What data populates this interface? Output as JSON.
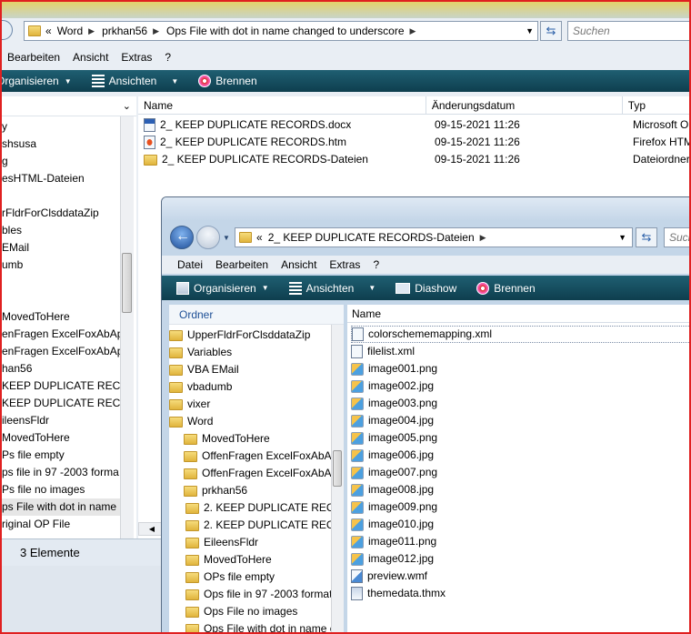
{
  "back_window": {
    "address": {
      "chevron": "«",
      "segments": [
        "Word",
        "prkhan56",
        "Ops File with dot in name changed to underscore"
      ]
    },
    "search_placeholder": "Suchen",
    "menu": [
      "Bearbeiten",
      "Ansicht",
      "Extras",
      "?"
    ],
    "commands": {
      "organize": "Organisieren",
      "views": "Ansichten",
      "burn": "Brennen"
    },
    "sidebar_items": [
      "y",
      "shsusa",
      "g",
      "esHTML-Dateien",
      "",
      "rFldrForClsddataZip",
      "bles",
      "EMail",
      "umb",
      "",
      "",
      "MovedToHere",
      "enFragen ExcelFoxAbAp",
      "enFragen ExcelFoxAbAp",
      "han56",
      "KEEP DUPLICATE RECO",
      "KEEP DUPLICATE RECO",
      "ileensFldr",
      "MovedToHere",
      "Ps file empty",
      "ps file in 97 -2003 forma",
      "Ps file no images",
      "ps File with dot in name",
      "riginal OP File"
    ],
    "columns": {
      "name": "Name",
      "date": "Änderungsdatum",
      "type": "Typ"
    },
    "files": [
      {
        "name": "2_ KEEP DUPLICATE RECORDS.docx",
        "date": "09-15-2021 11:26",
        "type": "Microsoft O",
        "icon": "word-doc-icon"
      },
      {
        "name": "2_ KEEP DUPLICATE RECORDS.htm",
        "date": "09-15-2021 11:26",
        "type": "Firefox HTM",
        "icon": "firefox-html-icon"
      },
      {
        "name": "2_ KEEP DUPLICATE RECORDS-Dateien",
        "date": "09-15-2021 11:26",
        "type": "Dateiordner",
        "icon": "folder-icon"
      }
    ],
    "status": "3 Elemente"
  },
  "front_window": {
    "address": {
      "chevron": "«",
      "segments": [
        "2_ KEEP DUPLICATE RECORDS-Dateien"
      ]
    },
    "search_placeholder": "Such",
    "menu": [
      "Datei",
      "Bearbeiten",
      "Ansicht",
      "Extras",
      "?"
    ],
    "commands": {
      "organize": "Organisieren",
      "views": "Ansichten",
      "slideshow": "Diashow",
      "burn": "Brennen"
    },
    "folder_header": "Ordner",
    "folders": [
      {
        "label": "UpperFldrForClsddataZip",
        "indent": 0
      },
      {
        "label": "Variables",
        "indent": 0
      },
      {
        "label": "VBA EMail",
        "indent": 0
      },
      {
        "label": "vbadumb",
        "indent": 0
      },
      {
        "label": "vixer",
        "indent": 0
      },
      {
        "label": "Word",
        "indent": 0
      },
      {
        "label": "MovedToHere",
        "indent": 1
      },
      {
        "label": "OffenFragen ExcelFoxAbApril.",
        "indent": 1
      },
      {
        "label": "OffenFragen ExcelFoxAbApril.",
        "indent": 1
      },
      {
        "label": "prkhan56",
        "indent": 1
      },
      {
        "label": "2. KEEP DUPLICATE RECORI",
        "indent": 2
      },
      {
        "label": "2. KEEP DUPLICATE RECORI",
        "indent": 2
      },
      {
        "label": "EileensFldr",
        "indent": 2
      },
      {
        "label": "MovedToHere",
        "indent": 2
      },
      {
        "label": "OPs file empty",
        "indent": 2
      },
      {
        "label": "Ops file in 97 -2003 format",
        "indent": 2
      },
      {
        "label": "Ops File no images",
        "indent": 2
      },
      {
        "label": "Ops File with dot in name c",
        "indent": 2
      }
    ],
    "name_header": "Name",
    "files": [
      {
        "name": "colorschememapping.xml",
        "kind": "xml"
      },
      {
        "name": "filelist.xml",
        "kind": "xml"
      },
      {
        "name": "image001.png",
        "kind": "img"
      },
      {
        "name": "image002.jpg",
        "kind": "img"
      },
      {
        "name": "image003.png",
        "kind": "img"
      },
      {
        "name": "image004.jpg",
        "kind": "img"
      },
      {
        "name": "image005.png",
        "kind": "img"
      },
      {
        "name": "image006.jpg",
        "kind": "img"
      },
      {
        "name": "image007.png",
        "kind": "img"
      },
      {
        "name": "image008.jpg",
        "kind": "img"
      },
      {
        "name": "image009.png",
        "kind": "img"
      },
      {
        "name": "image010.jpg",
        "kind": "img"
      },
      {
        "name": "image011.png",
        "kind": "img"
      },
      {
        "name": "image012.jpg",
        "kind": "img"
      },
      {
        "name": "preview.wmf",
        "kind": "wmf"
      },
      {
        "name": "themedata.thmx",
        "kind": "thmx"
      }
    ]
  }
}
